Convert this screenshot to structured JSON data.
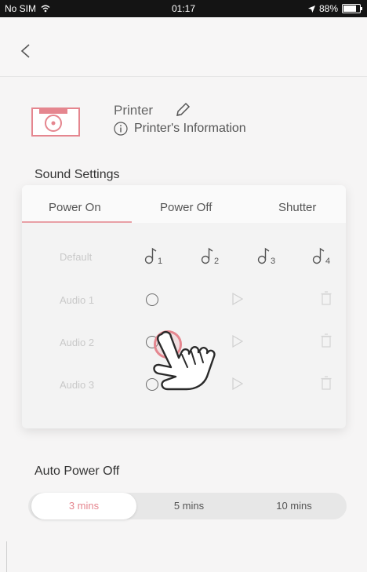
{
  "status_bar": {
    "carrier": "No SIM",
    "time": "01:17",
    "battery_percent": "88%",
    "battery_level": 0.88
  },
  "navbar": {
    "back_icon": "chevron-left-icon"
  },
  "printer": {
    "name": "Printer",
    "info_label": "Printer's Information",
    "accent_color": "#e5868f"
  },
  "sound_settings": {
    "title": "Sound Settings",
    "tabs": [
      {
        "label": "Power On",
        "active": true
      },
      {
        "label": "Power Off",
        "active": false
      },
      {
        "label": "Shutter",
        "active": false
      }
    ],
    "default_label": "Default",
    "default_sounds": [
      "1",
      "2",
      "3",
      "4"
    ],
    "audio_rows": [
      "Audio 1",
      "Audio 2",
      "Audio 3"
    ]
  },
  "auto_power_off": {
    "title": "Auto Power Off",
    "options": [
      {
        "label": "3 mins",
        "active": true
      },
      {
        "label": "5 mins",
        "active": false
      },
      {
        "label": "10 mins",
        "active": false
      }
    ]
  }
}
